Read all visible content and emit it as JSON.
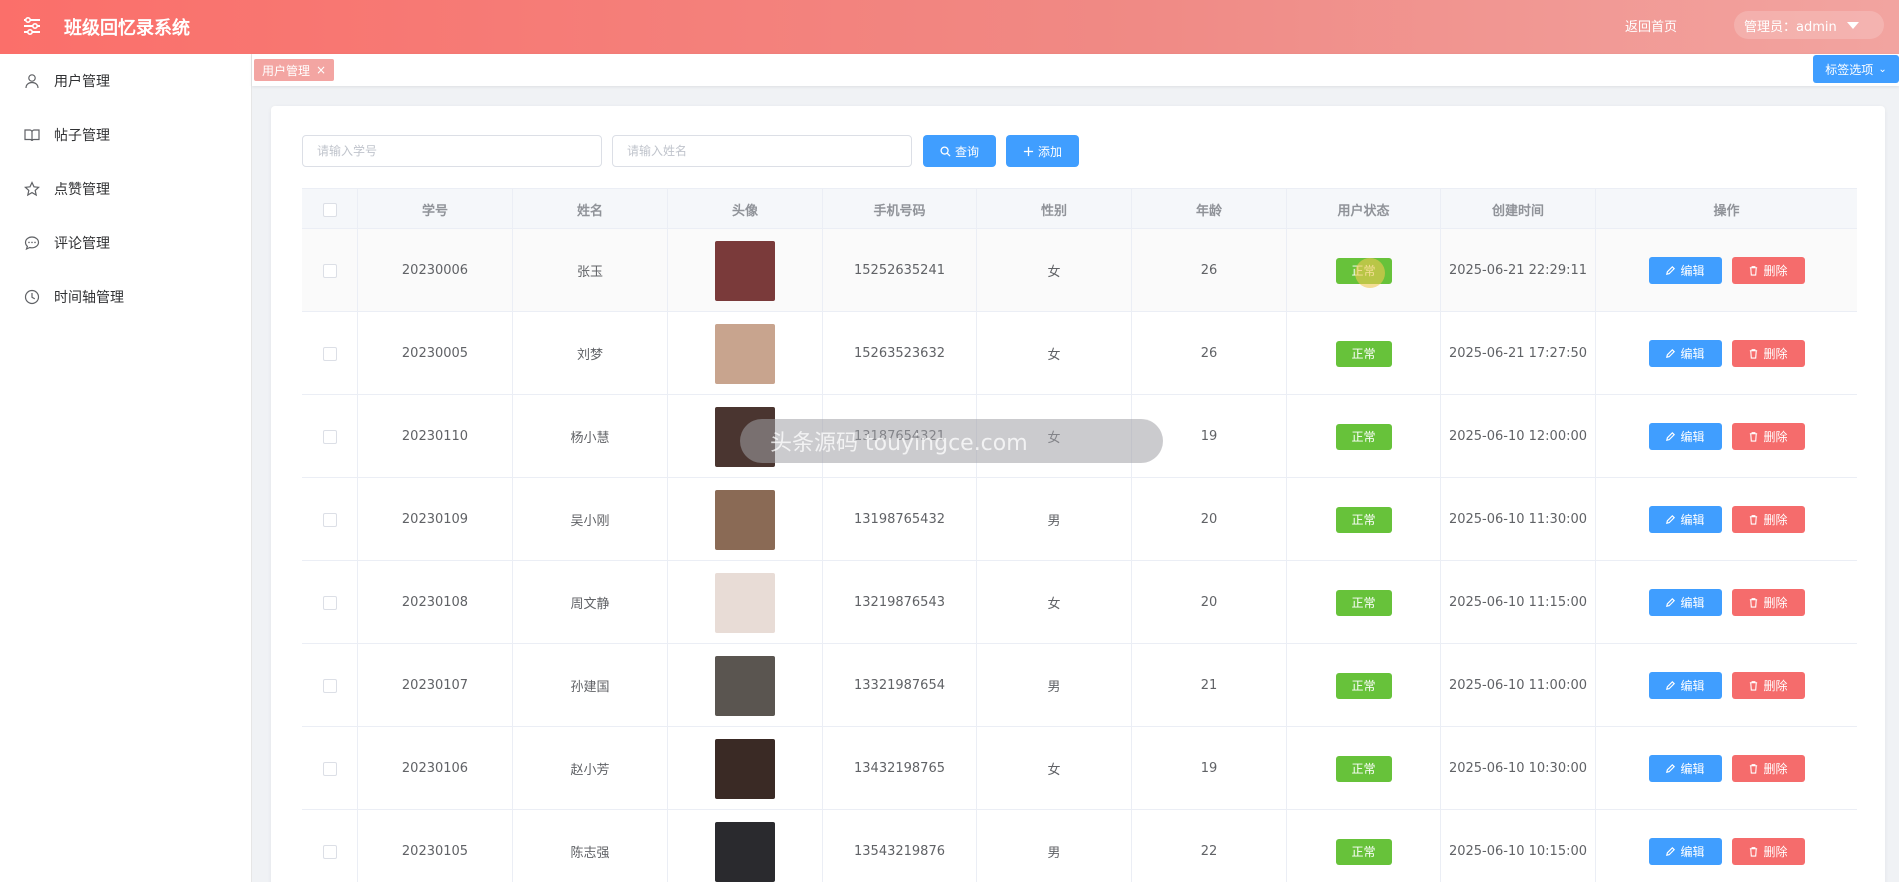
{
  "header": {
    "title": "班级回忆录系统",
    "home_link": "返回首页",
    "admin_label": "管理员：admin"
  },
  "sidebar": {
    "items": [
      {
        "label": "用户管理",
        "icon": "user-icon"
      },
      {
        "label": "帖子管理",
        "icon": "book-icon"
      },
      {
        "label": "点赞管理",
        "icon": "star-icon"
      },
      {
        "label": "评论管理",
        "icon": "comment-icon"
      },
      {
        "label": "时间轴管理",
        "icon": "clock-icon"
      }
    ]
  },
  "tags": {
    "active_tag": "用户管理",
    "close": "×",
    "options_label": "标签选项"
  },
  "search": {
    "student_id_placeholder": "请输入学号",
    "name_placeholder": "请输入姓名",
    "query_label": "查询",
    "add_label": "添加"
  },
  "table": {
    "columns": [
      "学号",
      "姓名",
      "头像",
      "手机号码",
      "性别",
      "年龄",
      "用户状态",
      "创建时间",
      "操作"
    ],
    "edit_label": "编辑",
    "delete_label": "删除",
    "rows": [
      {
        "id": "20230006",
        "name": "张玉",
        "phone": "15252635241",
        "gender": "女",
        "age": "26",
        "status": "正常",
        "created": "2025-06-21 22:29:11",
        "avatar_color": "#7a3a3a"
      },
      {
        "id": "20230005",
        "name": "刘梦",
        "phone": "15263523632",
        "gender": "女",
        "age": "26",
        "status": "正常",
        "created": "2025-06-21 17:27:50",
        "avatar_color": "#c8a48e"
      },
      {
        "id": "20230110",
        "name": "杨小慧",
        "phone": "13187654321",
        "gender": "女",
        "age": "19",
        "status": "正常",
        "created": "2025-06-10 12:00:00",
        "avatar_color": "#4a3530"
      },
      {
        "id": "20230109",
        "name": "吴小刚",
        "phone": "13198765432",
        "gender": "男",
        "age": "20",
        "status": "正常",
        "created": "2025-06-10 11:30:00",
        "avatar_color": "#8a6a55"
      },
      {
        "id": "20230108",
        "name": "周文静",
        "phone": "13219876543",
        "gender": "女",
        "age": "20",
        "status": "正常",
        "created": "2025-06-10 11:15:00",
        "avatar_color": "#e8dcd6"
      },
      {
        "id": "20230107",
        "name": "孙建国",
        "phone": "13321987654",
        "gender": "男",
        "age": "21",
        "status": "正常",
        "created": "2025-06-10 11:00:00",
        "avatar_color": "#5a5550"
      },
      {
        "id": "20230106",
        "name": "赵小芳",
        "phone": "13432198765",
        "gender": "女",
        "age": "19",
        "status": "正常",
        "created": "2025-06-10 10:30:00",
        "avatar_color": "#3a2a25"
      },
      {
        "id": "20230105",
        "name": "陈志强",
        "phone": "13543219876",
        "gender": "男",
        "age": "22",
        "status": "正常",
        "created": "2025-06-10 10:15:00",
        "avatar_color": "#2a2a2e"
      }
    ]
  },
  "watermark": "头条源码 touyingce.com",
  "colors": {
    "primary": "#409eff",
    "danger": "#f56c6c",
    "success": "#67c23a",
    "header_start": "#fb6f6a"
  }
}
